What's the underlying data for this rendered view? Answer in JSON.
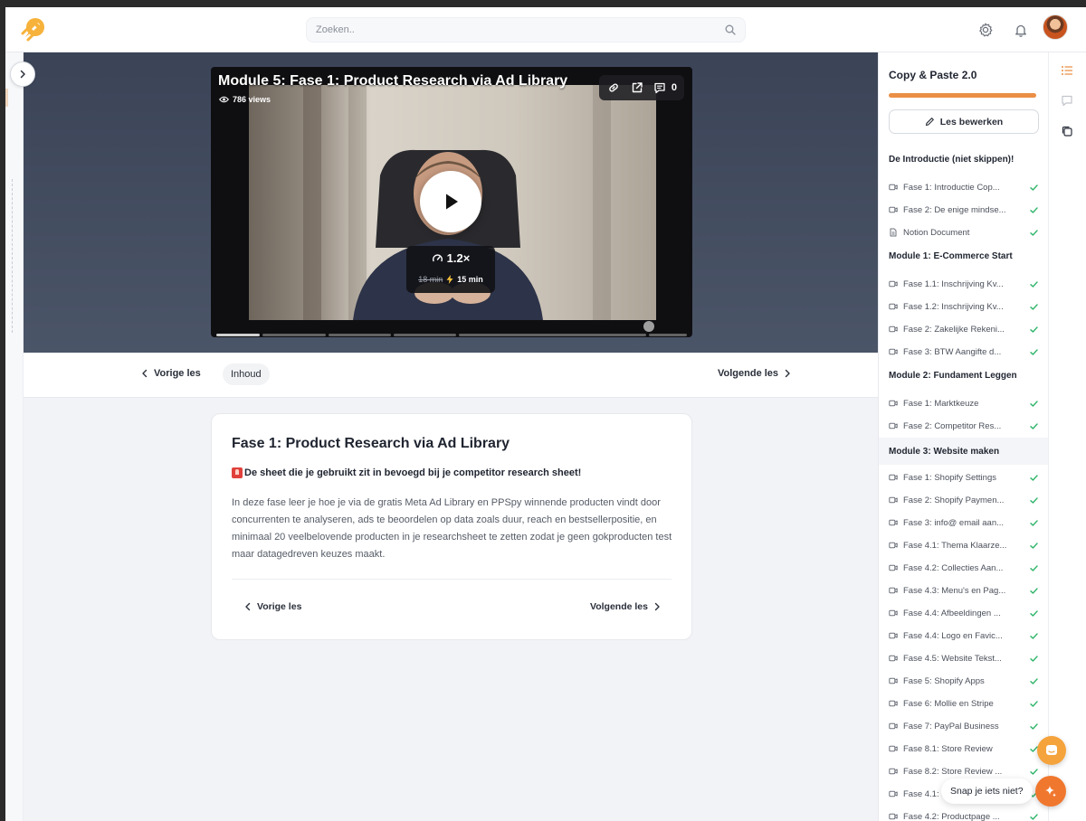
{
  "header": {
    "search_placeholder": "Zoeken..",
    "icons": [
      "rocket-logo",
      "search-icon",
      "gear-icon",
      "bell-icon",
      "avatar"
    ]
  },
  "video": {
    "title": "Module 5: Fase 1: Product Research via Ad Library",
    "views": "786 views",
    "comments_count": "0",
    "speed": "1.2×",
    "original_duration": "18 min",
    "fast_duration": "15 min"
  },
  "lesson_nav": {
    "prev": "Vorige les",
    "contents": "Inhoud",
    "next": "Volgende les"
  },
  "lesson": {
    "title": "Fase 1: Product Research via Ad Library",
    "note": "De sheet die je gebruikt zit in bevoegd bij je competitor research sheet!",
    "body": "In deze fase leer je hoe je via de gratis Meta Ad Library en PPSpy winnende producten vindt door concurrenten te analyseren, ads te beoordelen op data zoals duur, reach en bestsellerpositie, en minimaal 20 veelbelovende producten in je researchsheet te zetten zodat je geen gokproducten test maar datagedreven keuzes maakt.",
    "prev": "Vorige les",
    "next": "Volgende les"
  },
  "sidebar": {
    "course_title": "Copy & Paste 2.0",
    "progress": 1.0,
    "edit_label": "Les bewerken",
    "sections": [
      {
        "title": "De Introductie (niet skippen)!",
        "items": [
          {
            "label": "Fase 1: Introductie Cop...",
            "type": "video",
            "done": true
          },
          {
            "label": "Fase 2: De enige mindse...",
            "type": "video",
            "done": true
          },
          {
            "label": "Notion Document",
            "type": "document",
            "done": true
          }
        ]
      },
      {
        "title": "Module 1: E-Commerce Start",
        "items": [
          {
            "label": "Fase 1.1: Inschrijving Kv...",
            "type": "video",
            "done": true
          },
          {
            "label": "Fase 1.2: Inschrijving Kv...",
            "type": "video",
            "done": true
          },
          {
            "label": "Fase 2: Zakelijke Rekeni...",
            "type": "video",
            "done": true
          },
          {
            "label": "Fase 3: BTW Aangifte d...",
            "type": "video",
            "done": true
          }
        ]
      },
      {
        "title": "Module 2: Fundament Leggen",
        "items": [
          {
            "label": "Fase 1: Marktkeuze",
            "type": "video",
            "done": true
          },
          {
            "label": "Fase 2: Competitor Res...",
            "type": "video",
            "done": true
          }
        ]
      },
      {
        "title": "Module 3: Website maken",
        "active": true,
        "items": [
          {
            "label": "Fase 1: Shopify Settings",
            "type": "video",
            "done": true
          },
          {
            "label": "Fase 2: Shopify Paymen...",
            "type": "video",
            "done": true
          },
          {
            "label": "Fase 3: info@ email aan...",
            "type": "video",
            "done": true
          },
          {
            "label": "Fase 4.1: Thema Klaarze...",
            "type": "video",
            "done": true
          },
          {
            "label": "Fase 4.2: Collecties Aan...",
            "type": "video",
            "done": true
          },
          {
            "label": "Fase 4.3: Menu's en Pag...",
            "type": "video",
            "done": true
          },
          {
            "label": "Fase 4.4: Afbeeldingen ...",
            "type": "video",
            "done": true
          },
          {
            "label": "Fase 4.4: Logo en Favic...",
            "type": "video",
            "done": true
          },
          {
            "label": "Fase 4.5: Website Tekst...",
            "type": "video",
            "done": true
          },
          {
            "label": "Fase 5: Shopify Apps",
            "type": "video",
            "done": true
          },
          {
            "label": "Fase 6: Mollie en Stripe",
            "type": "video",
            "done": true
          },
          {
            "label": "Fase 7: PayPal Business",
            "type": "video",
            "done": true
          },
          {
            "label": "Fase 8.1: Store Review",
            "type": "video",
            "done": true
          },
          {
            "label": "Fase 8.2: Store Review ...",
            "type": "video",
            "done": true
          },
          {
            "label": "Fase 4.1: S",
            "type": "video",
            "done": true
          },
          {
            "label": "Fase 4.2: Productpage ...",
            "type": "video",
            "done": true
          }
        ]
      }
    ]
  },
  "help": {
    "bubble": "Snap je iets niet?"
  },
  "colors": {
    "accent": "#ea8f45",
    "check": "#2fb56a",
    "stage": "#424b5e"
  }
}
